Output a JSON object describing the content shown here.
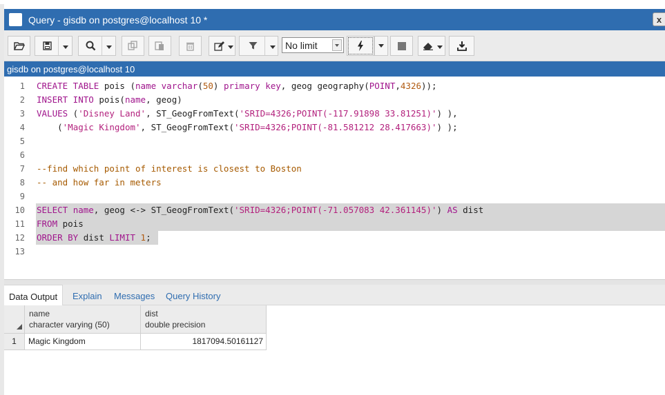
{
  "window": {
    "title": "Query - gisdb on postgres@localhost 10 *",
    "close_label": "x"
  },
  "toolbar": {
    "limit_value": "No limit",
    "buttons": [
      "open-file-icon",
      "save-icon",
      "search-icon",
      "copy-icon",
      "paste-icon",
      "delete-icon",
      "edit-icon",
      "filter-icon",
      "execute-icon",
      "stop-icon",
      "clear-icon",
      "download-icon"
    ]
  },
  "connection": {
    "label": "gisdb on postgres@localhost 10"
  },
  "editor": {
    "line_numbers": [
      "1",
      "2",
      "3",
      "4",
      "5",
      "6",
      "7",
      "8",
      "9",
      "10",
      "11",
      "12",
      "13"
    ]
  },
  "results": {
    "tabs": [
      "Data Output",
      "Explain",
      "Messages",
      "Query History"
    ],
    "columns": [
      {
        "name": "name",
        "type": "character varying (50)"
      },
      {
        "name": "dist",
        "type": "double precision"
      }
    ],
    "rows": [
      {
        "index": "1",
        "name": "Magic Kingdom",
        "dist": "1817094.50161127"
      }
    ]
  },
  "colors": {
    "accent": "#2f6db0",
    "keyword": "#a0158c",
    "string": "#b3217d",
    "comment": "#a65a00",
    "selection": "#d6d6d6"
  }
}
